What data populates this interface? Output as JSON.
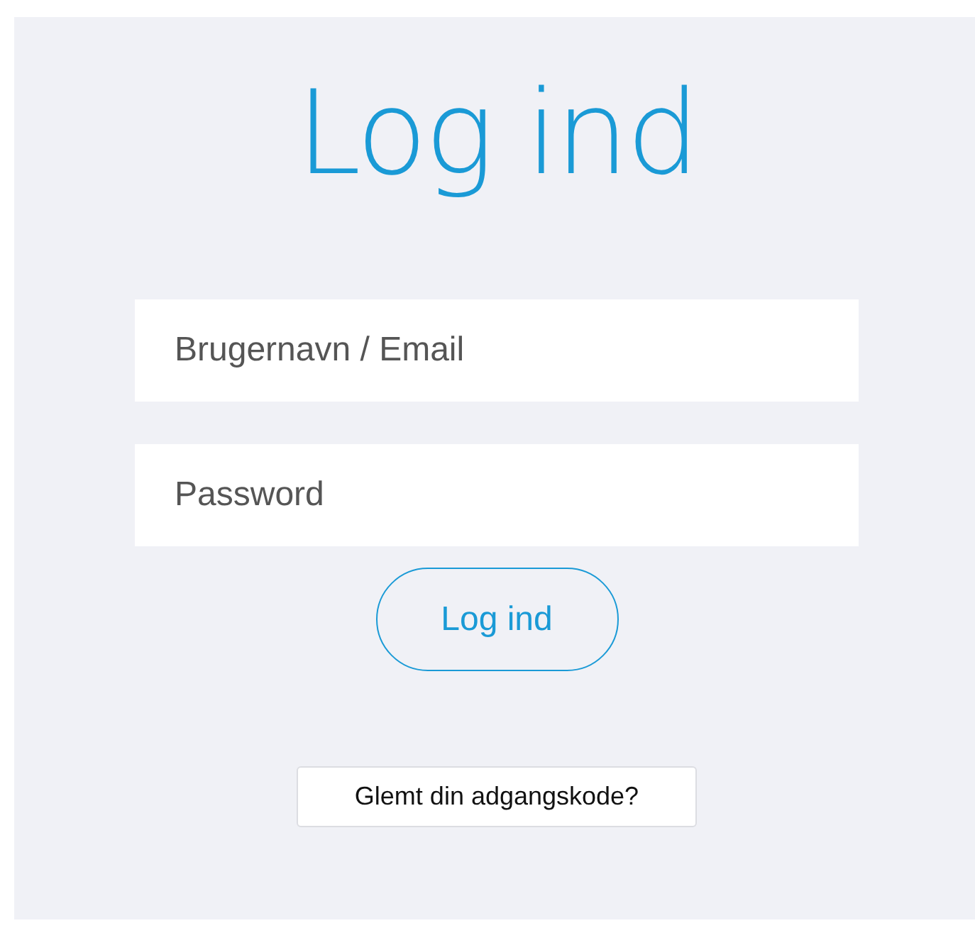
{
  "title": "Log ind",
  "fields": [
    {
      "placeholder": "Brugernavn / Email"
    },
    {
      "placeholder": "Password"
    }
  ],
  "submit_button": "Log ind",
  "forgot_button": "Glemt din adgangskode?"
}
